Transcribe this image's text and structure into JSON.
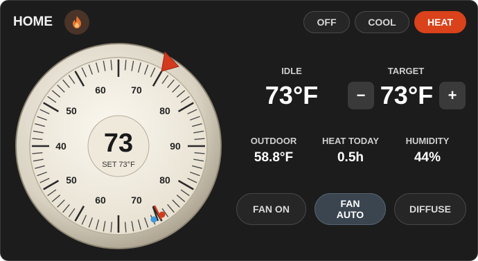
{
  "header": {
    "title": "HOME"
  },
  "modes": [
    {
      "label": "OFF",
      "active": false
    },
    {
      "label": "COOL",
      "active": false
    },
    {
      "label": "HEAT",
      "active": true
    }
  ],
  "dial": {
    "current": "73",
    "set_text": "SET 73°F",
    "tick_labels": [
      "40",
      "50",
      "60",
      "70",
      "80",
      "90",
      "80",
      "70",
      "60",
      "50"
    ]
  },
  "status": {
    "state_label": "IDLE",
    "state_temp": "73°F",
    "target_label": "TARGET",
    "target_temp": "73°F",
    "minus": "−",
    "plus": "+"
  },
  "stats": [
    {
      "label": "OUTDOOR",
      "value": "58.8°F"
    },
    {
      "label": "HEAT TODAY",
      "value": "0.5h"
    },
    {
      "label": "HUMIDITY",
      "value": "44%"
    }
  ],
  "fan": [
    {
      "label": "FAN ON",
      "active": false
    },
    {
      "label": "FAN\nAUTO",
      "active": true
    },
    {
      "label": "DIFFUSE",
      "active": false
    }
  ],
  "colors": {
    "accent": "#d9421a",
    "flame": "#e8762c",
    "background": "#1c1c1c"
  }
}
